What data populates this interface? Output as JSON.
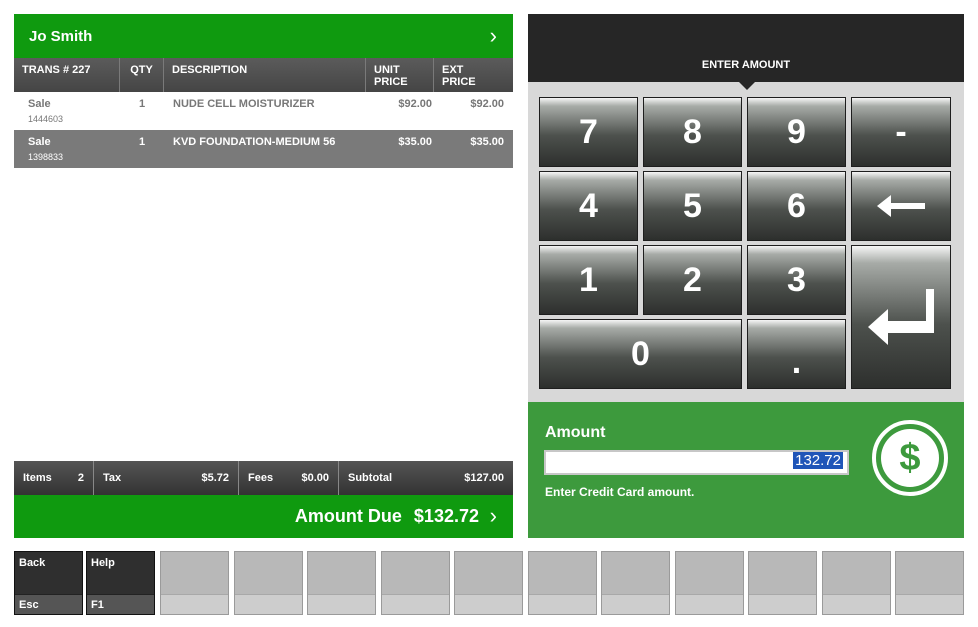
{
  "customer": {
    "name": "Jo Smith",
    "chevron": "›"
  },
  "table": {
    "headers": {
      "trans": "TRANS # 227",
      "qty": "QTY",
      "description": "DESCRIPTION",
      "unit_price_1": "UNIT",
      "unit_price_2": "PRICE",
      "ext_price_1": "EXT",
      "ext_price_2": "PRICE"
    },
    "rows": [
      {
        "type": "Sale",
        "code": "1444603",
        "qty": "1",
        "description": "NUDE CELL MOISTURIZER",
        "unit": "$92.00",
        "ext": "$92.00",
        "selected": false
      },
      {
        "type": "Sale",
        "code": "1398833",
        "qty": "1",
        "description": "KVD FOUNDATION-MEDIUM 56",
        "unit": "$35.00",
        "ext": "$35.00",
        "selected": true
      }
    ]
  },
  "totals": {
    "items_label": "Items",
    "items_value": "2",
    "tax_label": "Tax",
    "tax_value": "$5.72",
    "fees_label": "Fees",
    "fees_value": "$0.00",
    "subtotal_label": "Subtotal",
    "subtotal_value": "$127.00"
  },
  "amount_due": {
    "label": "Amount Due",
    "value": "$132.72",
    "chevron": "›"
  },
  "keypad": {
    "title": "ENTER AMOUNT",
    "keys": {
      "k7": "7",
      "k8": "8",
      "k9": "9",
      "minus": "-",
      "k4": "4",
      "k5": "5",
      "k6": "6",
      "backspace": "backspace-arrow-icon",
      "k1": "1",
      "k2": "2",
      "k3": "3",
      "enter": "enter-arrow-icon",
      "k0": "0",
      "dot": "."
    }
  },
  "amount_panel": {
    "label": "Amount",
    "value": "132.72",
    "hint": "Enter Credit Card amount.",
    "icon": "dollar-circle-icon",
    "colors": {
      "panel": "#3d9a3d",
      "selection": "#1f55b8"
    }
  },
  "function_keys": [
    {
      "name": "Back",
      "shortcut": "Esc"
    },
    {
      "name": "Help",
      "shortcut": "F1"
    }
  ],
  "colors": {
    "header_green": "#0f9a0f",
    "dark_bar": "#262626"
  }
}
